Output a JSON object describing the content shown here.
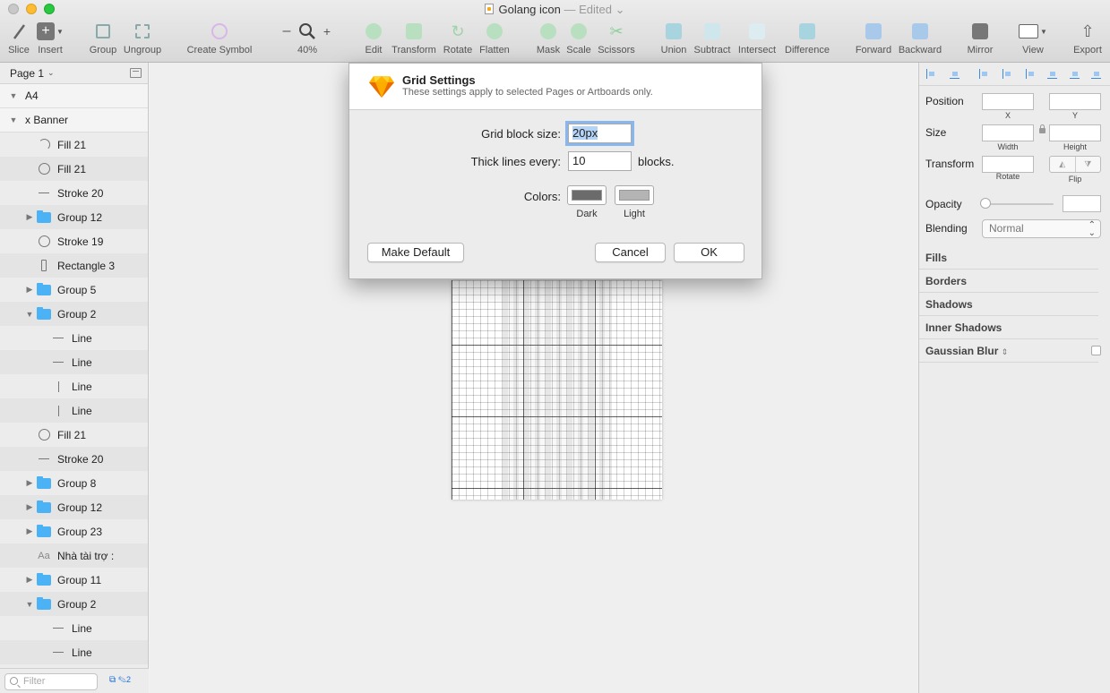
{
  "window": {
    "title": "Golang icon",
    "edited": "— Edited",
    "colors": {
      "accent": "#3a8be0",
      "folder": "#4ab2f5",
      "focus_ring": "#8ab6ee"
    }
  },
  "toolbar": {
    "slice": "Slice",
    "insert": "Insert",
    "group": "Group",
    "ungroup": "Ungroup",
    "create_symbol": "Create Symbol",
    "zoom_minus": "–",
    "zoom_plus": "+",
    "zoom_level": "40%",
    "edit": "Edit",
    "transform": "Transform",
    "rotate": "Rotate",
    "flatten": "Flatten",
    "mask": "Mask",
    "scale": "Scale",
    "scissors": "Scissors",
    "union": "Union",
    "subtract": "Subtract",
    "intersect": "Intersect",
    "difference": "Difference",
    "forward": "Forward",
    "backward": "Backward",
    "mirror": "Mirror",
    "view": "View",
    "export": "Export"
  },
  "sidebar": {
    "page": "Page 1",
    "layers": [
      {
        "label": "A4",
        "icon": "none",
        "indent": 0,
        "disclosure": "open"
      },
      {
        "label": "x Banner",
        "icon": "none",
        "indent": 0,
        "disclosure": "open"
      },
      {
        "label": "Fill 21",
        "icon": "arc-icon",
        "indent": 1,
        "disclosure": "none"
      },
      {
        "label": "Fill 21",
        "icon": "circle-icon",
        "indent": 1,
        "disclosure": "none"
      },
      {
        "label": "Stroke 20",
        "icon": "line-icon",
        "indent": 1,
        "disclosure": "none"
      },
      {
        "label": "Group 12",
        "icon": "folder-icon",
        "indent": 1,
        "disclosure": "closed"
      },
      {
        "label": "Stroke 19",
        "icon": "circle-icon",
        "indent": 1,
        "disclosure": "none"
      },
      {
        "label": "Rectangle 3",
        "icon": "rectangle-icon",
        "indent": 1,
        "disclosure": "none"
      },
      {
        "label": "Group 5",
        "icon": "folder-icon",
        "indent": 1,
        "disclosure": "closed"
      },
      {
        "label": "Group 2",
        "icon": "folder-icon",
        "indent": 1,
        "disclosure": "open"
      },
      {
        "label": "Line",
        "icon": "line-icon",
        "indent": 2,
        "disclosure": "none"
      },
      {
        "label": "Line",
        "icon": "line-icon",
        "indent": 2,
        "disclosure": "none"
      },
      {
        "label": "Line",
        "icon": "vertical-line-icon",
        "indent": 2,
        "disclosure": "none"
      },
      {
        "label": "Line",
        "icon": "vertical-line-icon",
        "indent": 2,
        "disclosure": "none"
      },
      {
        "label": "Fill 21",
        "icon": "circle-icon",
        "indent": 1,
        "disclosure": "none"
      },
      {
        "label": "Stroke 20",
        "icon": "line-icon",
        "indent": 1,
        "disclosure": "none"
      },
      {
        "label": "Group 8",
        "icon": "folder-icon",
        "indent": 1,
        "disclosure": "closed"
      },
      {
        "label": "Group 12",
        "icon": "folder-icon",
        "indent": 1,
        "disclosure": "closed"
      },
      {
        "label": "Group 23",
        "icon": "folder-icon",
        "indent": 1,
        "disclosure": "closed"
      },
      {
        "label": "Nhà tài trợ :",
        "icon": "text-icon",
        "indent": 1,
        "disclosure": "none"
      },
      {
        "label": "Group 11",
        "icon": "folder-icon",
        "indent": 1,
        "disclosure": "closed"
      },
      {
        "label": "Group 2",
        "icon": "folder-icon",
        "indent": 1,
        "disclosure": "open"
      },
      {
        "label": "Line",
        "icon": "line-icon",
        "indent": 2,
        "disclosure": "none"
      },
      {
        "label": "Line",
        "icon": "line-icon",
        "indent": 2,
        "disclosure": "none"
      }
    ],
    "text_icon_glyph": "Aa",
    "filter_placeholder": "Filter",
    "badge_count": "2"
  },
  "dialog": {
    "title": "Grid Settings",
    "subtitle": "These settings apply to selected Pages or Artboards only.",
    "grid_block_label": "Grid block size:",
    "grid_block_value": "20px",
    "thick_lines_label": "Thick lines every:",
    "thick_lines_value": "10",
    "thick_lines_suffix": "blocks.",
    "colors_label": "Colors:",
    "dark_label": "Dark",
    "light_label": "Light",
    "dark_color": "#6b6b6b",
    "light_color": "#b4b4b4",
    "make_default": "Make Default",
    "cancel": "Cancel",
    "ok": "OK"
  },
  "inspector": {
    "position": "Position",
    "x": "X",
    "y": "Y",
    "size": "Size",
    "width": "Width",
    "height": "Height",
    "transform": "Transform",
    "rotate": "Rotate",
    "flip": "Flip",
    "opacity": "Opacity",
    "blending": "Blending",
    "blending_value": "Normal",
    "fills": "Fills",
    "borders": "Borders",
    "shadows": "Shadows",
    "inner_shadows": "Inner Shadows",
    "gaussian_blur": "Gaussian Blur"
  }
}
